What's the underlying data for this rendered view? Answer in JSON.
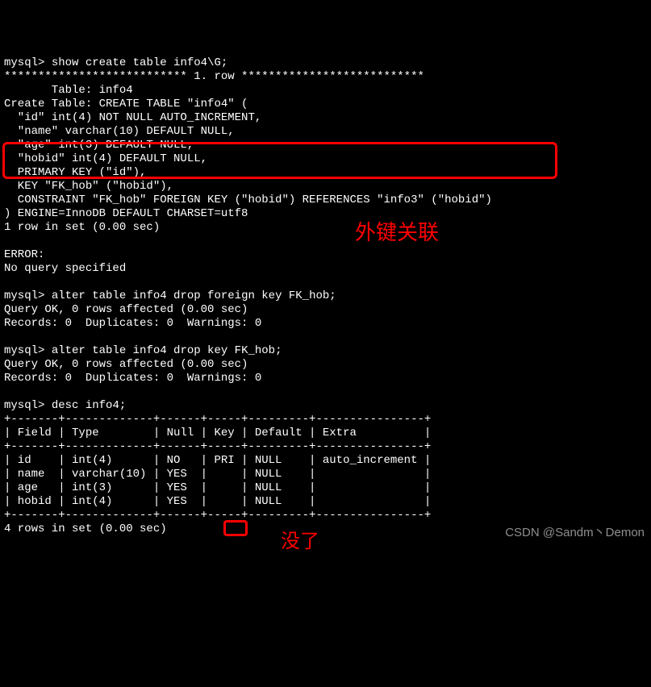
{
  "prompt": "mysql>",
  "cmds": {
    "show_create": "show create table info4\\G;",
    "alter_drop_fk": "alter table info4 drop foreign key FK_hob;",
    "alter_drop_key": "alter table info4 drop key FK_hob;",
    "desc": "desc info4;"
  },
  "out": {
    "row_sep": "*************************** 1. row ***************************",
    "table_label": "       Table: info4",
    "create_l1": "Create Table: CREATE TABLE \"info4\" (",
    "create_l2": "  \"id\" int(4) NOT NULL AUTO_INCREMENT,",
    "create_l3": "  \"name\" varchar(10) DEFAULT NULL,",
    "create_l4": "  \"age\" int(3) DEFAULT NULL,",
    "create_l5": "  \"hobid\" int(4) DEFAULT NULL,",
    "create_l6": "  PRIMARY KEY (\"id\"),",
    "create_l7": "  KEY \"FK_hob\" (\"hobid\"),",
    "create_l8": "  CONSTRAINT \"FK_hob\" FOREIGN KEY (\"hobid\") REFERENCES \"info3\" (\"hobid\")",
    "create_l9": ") ENGINE=InnoDB DEFAULT CHARSET=utf8",
    "one_row": "1 row in set (0.00 sec)",
    "error_label": "ERROR:",
    "no_query": "No query specified",
    "query_ok": "Query OK, 0 rows affected (0.00 sec)",
    "records": "Records: 0  Duplicates: 0  Warnings: 0",
    "four_rows": "4 rows in set (0.00 sec)"
  },
  "table": {
    "border": "+-------+-------------+------+-----+---------+----------------+",
    "header": "| Field | Type        | Null | Key | Default | Extra          |",
    "r1": "| id    | int(4)      | NO   | PRI | NULL    | auto_increment |",
    "r2": "| name  | varchar(10) | YES  |     | NULL    |                |",
    "r3": "| age   | int(3)      | YES  |     | NULL    |                |",
    "r4": "| hobid | int(4)      | YES  |     | NULL    |                |"
  },
  "annotations": {
    "fk_label": "外键关联",
    "gone_label": "没了"
  },
  "watermark": "CSDN @Sandm丶Demon",
  "chart_data": {
    "type": "table",
    "title": "desc info4",
    "columns": [
      "Field",
      "Type",
      "Null",
      "Key",
      "Default",
      "Extra"
    ],
    "rows": [
      [
        "id",
        "int(4)",
        "NO",
        "PRI",
        "NULL",
        "auto_increment"
      ],
      [
        "name",
        "varchar(10)",
        "YES",
        "",
        "NULL",
        ""
      ],
      [
        "age",
        "int(3)",
        "YES",
        "",
        "NULL",
        ""
      ],
      [
        "hobid",
        "int(4)",
        "YES",
        "",
        "NULL",
        ""
      ]
    ]
  }
}
